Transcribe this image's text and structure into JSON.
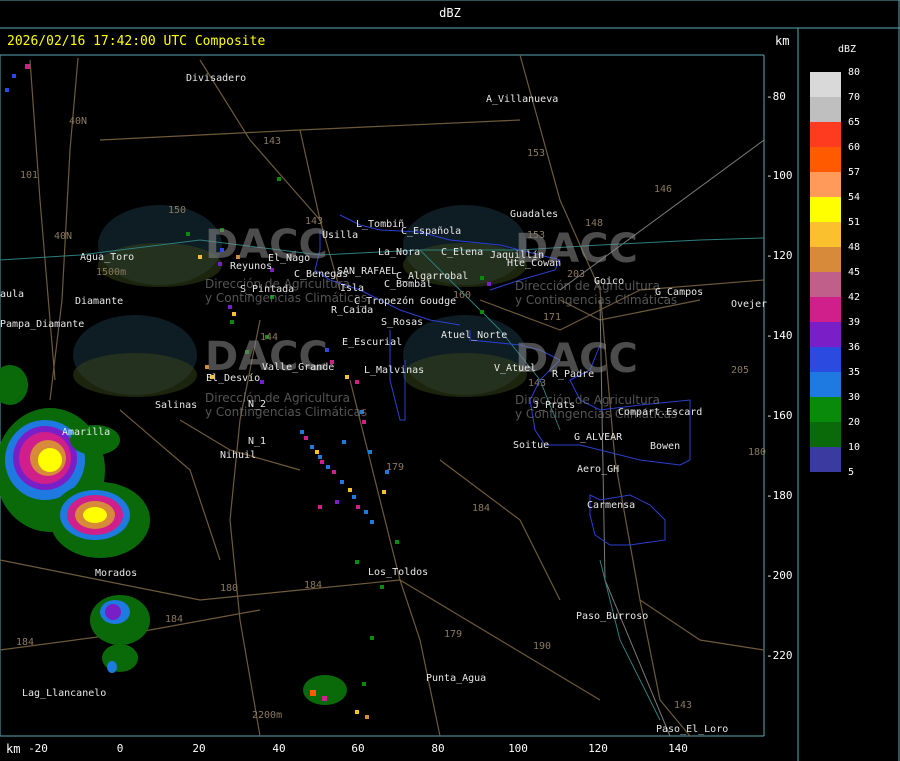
{
  "header": {
    "title": "dBZ"
  },
  "map": {
    "timestamp": "2026/02/16 17:42:00 UTC Composite",
    "unit_top": "km",
    "unit_bottom": "km",
    "y_ticks": [
      "-80",
      "-100",
      "-120",
      "-140",
      "-160",
      "-180",
      "-200",
      "-220"
    ],
    "x_ticks": [
      "-20",
      "0",
      "20",
      "40",
      "60",
      "80",
      "100",
      "120",
      "140"
    ]
  },
  "legend": {
    "title": "dBZ",
    "items": [
      {
        "label": "80",
        "color": "#d9d9d9"
      },
      {
        "label": "70",
        "color": "#bfbfbf"
      },
      {
        "label": "65",
        "color": "#ff3b1f"
      },
      {
        "label": "60",
        "color": "#ff5a00"
      },
      {
        "label": "57",
        "color": "#ff9a5a"
      },
      {
        "label": "54",
        "color": "#ffff00"
      },
      {
        "label": "51",
        "color": "#fbc02d"
      },
      {
        "label": "48",
        "color": "#d78a3a"
      },
      {
        "label": "45",
        "color": "#c0608a"
      },
      {
        "label": "42",
        "color": "#d01e8a"
      },
      {
        "label": "39",
        "color": "#7a1ec8"
      },
      {
        "label": "36",
        "color": "#2a4ae0"
      },
      {
        "label": "35",
        "color": "#1e7ae0"
      },
      {
        "label": "30",
        "color": "#0a8a0a"
      },
      {
        "label": "20",
        "color": "#0a6a0a"
      },
      {
        "label": "10",
        "color": "#3a3aa0"
      },
      {
        "label": "5",
        "color": ""
      }
    ]
  },
  "watermark": {
    "brand": "DACC",
    "subtitle_1": "Dirección de Agricultura",
    "subtitle_2": "y Contingencias Climáticas"
  },
  "places": [
    "Divisadero",
    "A_Villanueva",
    "Guadales",
    "L_Tombiñ",
    "Usilla",
    "C_Española",
    "La_Nora",
    "C_Elena",
    "Jaquillín",
    "Hte_Cowan",
    "Goico",
    "G_Campos",
    "Ovejer",
    "Agua_Toro",
    "Reyunos",
    "El_Nago",
    "C_Benegas",
    "SAN_RAFAEL",
    "C_Algarrobal",
    "S_Pintada",
    "C_Bombal",
    "Isla",
    "C_Tropezón",
    "Goudge",
    "R_Caida",
    "S_Rosas",
    "Atuel_Norte",
    "E_Escurial",
    "Valle_Grande",
    "L_Malvinas",
    "V_Atuel",
    "R_Padre",
    "El_Desvío",
    "Salinas",
    "N_2",
    "N_1",
    "Nihuil",
    "J_Prats",
    "Compart.Escard",
    "G_ALVEAR",
    "Soitue",
    "Bowen",
    "Aero_GH",
    "Carmensa",
    "Pampa_Diamante",
    "aula",
    "Morados",
    "Los_Toldos",
    "Paso_Burroso",
    "Punta_Agua",
    "Lag_Llancanelo",
    "Paso_El_Loro",
    "Amarilla",
    "Diamante"
  ],
  "roads": [
    "40N",
    "40N",
    "101",
    "143",
    "153",
    "146",
    "150",
    "143",
    "148",
    "203",
    "171",
    "144",
    "160",
    "153",
    "205",
    "143",
    "179",
    "184",
    "180",
    "184",
    "184",
    "179",
    "190",
    "143",
    "2200m",
    "1500m",
    "180",
    "184"
  ]
}
